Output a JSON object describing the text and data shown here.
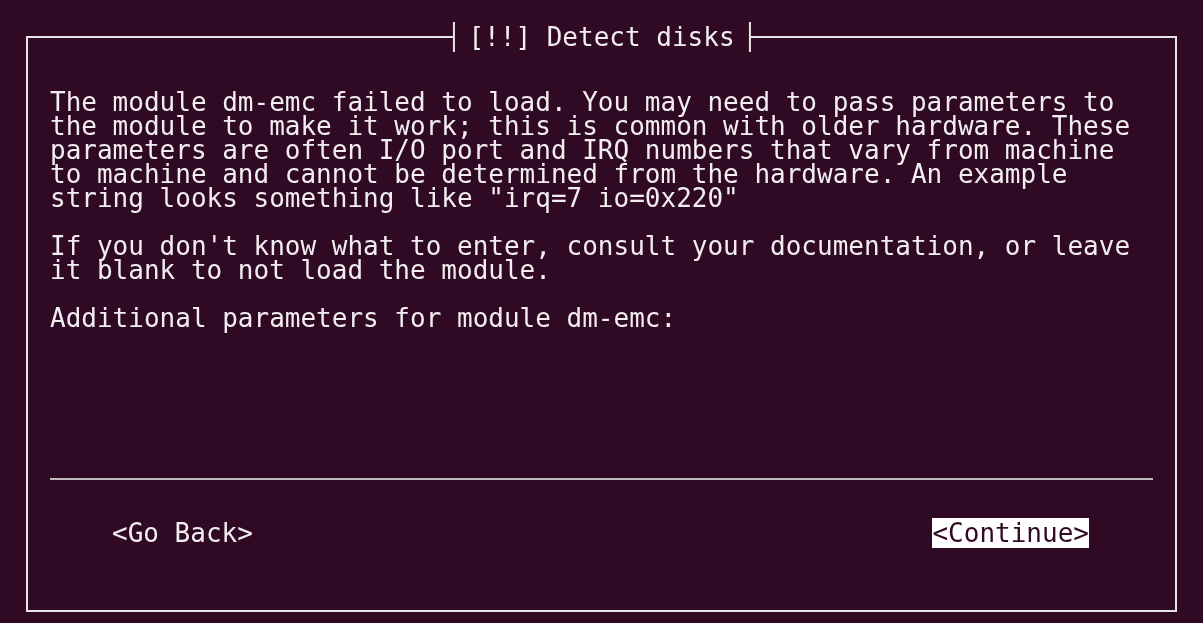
{
  "dialog": {
    "title": "[!!] Detect disks",
    "paragraphs": [
      "The module dm-emc failed to load. You may need to pass parameters to the module to make it work; this is common with older hardware. These parameters are often I/O port and IRQ numbers that vary from machine to machine and cannot be determined from the hardware. An example string looks something like \"irq=7 io=0x220\"",
      "If you don't know what to enter, consult your documentation, or leave it blank to not load the module.",
      "Additional parameters for module dm-emc:"
    ],
    "buttons": [
      {
        "label": "<Go Back>",
        "selected": false
      },
      {
        "label": "<Continue>",
        "selected": true
      }
    ]
  }
}
